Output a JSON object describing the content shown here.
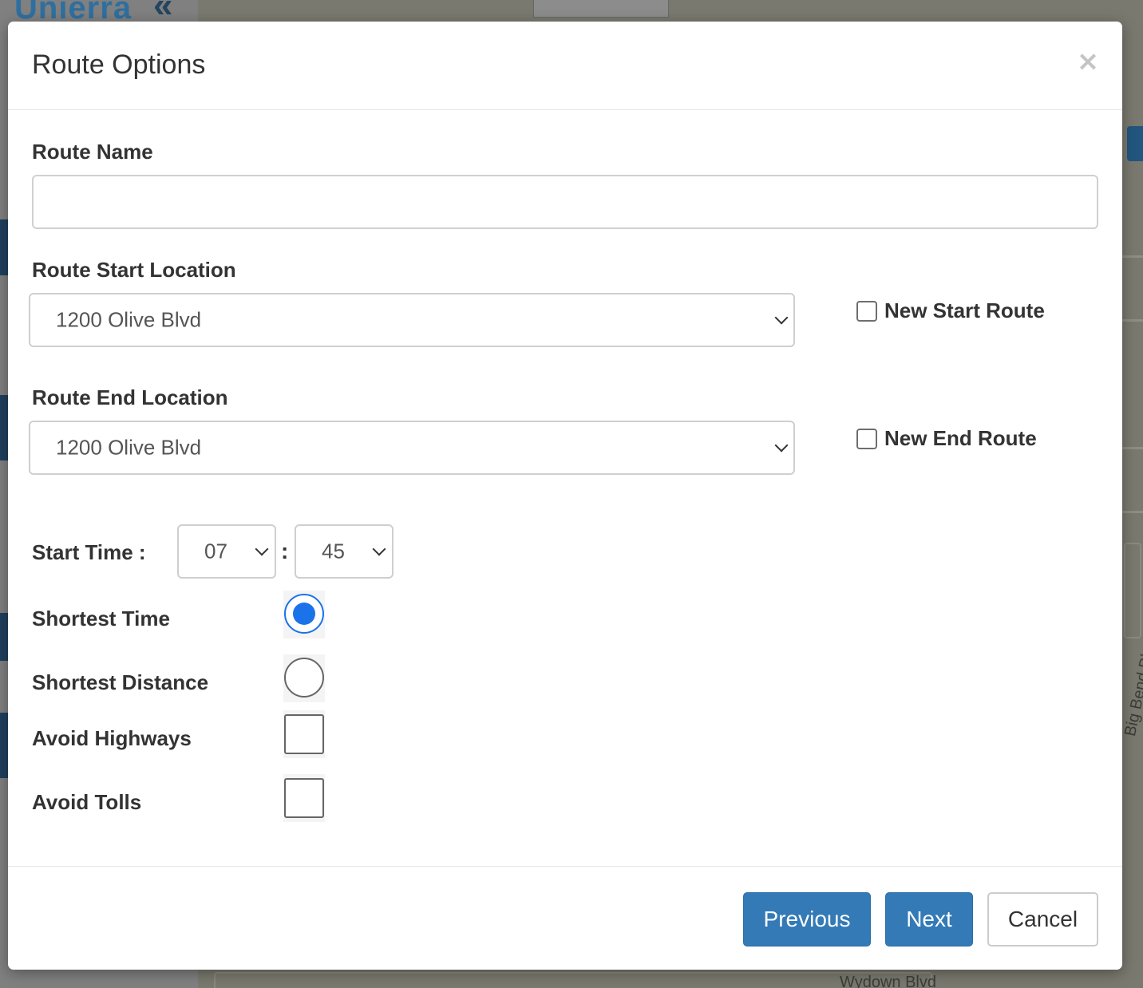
{
  "background": {
    "logo": "Unierra",
    "streets": [
      "Big Bend Blvd",
      "Wydown Blvd"
    ]
  },
  "modal": {
    "title": "Route Options",
    "close_glyph": "×"
  },
  "form": {
    "route_name": {
      "label": "Route Name",
      "value": "",
      "placeholder": ""
    },
    "start_location": {
      "label": "Route Start Location",
      "selected": "1200 Olive Blvd",
      "new_route_label": "New Start Route",
      "new_route_checked": false
    },
    "end_location": {
      "label": "Route End Location",
      "selected": "1200 Olive Blvd",
      "new_route_label": "New End Route",
      "new_route_checked": false
    },
    "start_time": {
      "label": "Start Time :",
      "hour": "07",
      "separator": ":",
      "minute": "45"
    },
    "options": {
      "shortest_time": {
        "label": "Shortest Time",
        "selected": true
      },
      "shortest_distance": {
        "label": "Shortest Distance",
        "selected": false
      },
      "avoid_highways": {
        "label": "Avoid Highways",
        "checked": false
      },
      "avoid_tolls": {
        "label": "Avoid Tolls",
        "checked": false
      }
    }
  },
  "footer": {
    "previous_label": "Previous",
    "next_label": "Next",
    "cancel_label": "Cancel"
  },
  "colors": {
    "primary": "#337ab7",
    "radio_accent": "#1a73e8",
    "overlay_map": "#79796f"
  }
}
